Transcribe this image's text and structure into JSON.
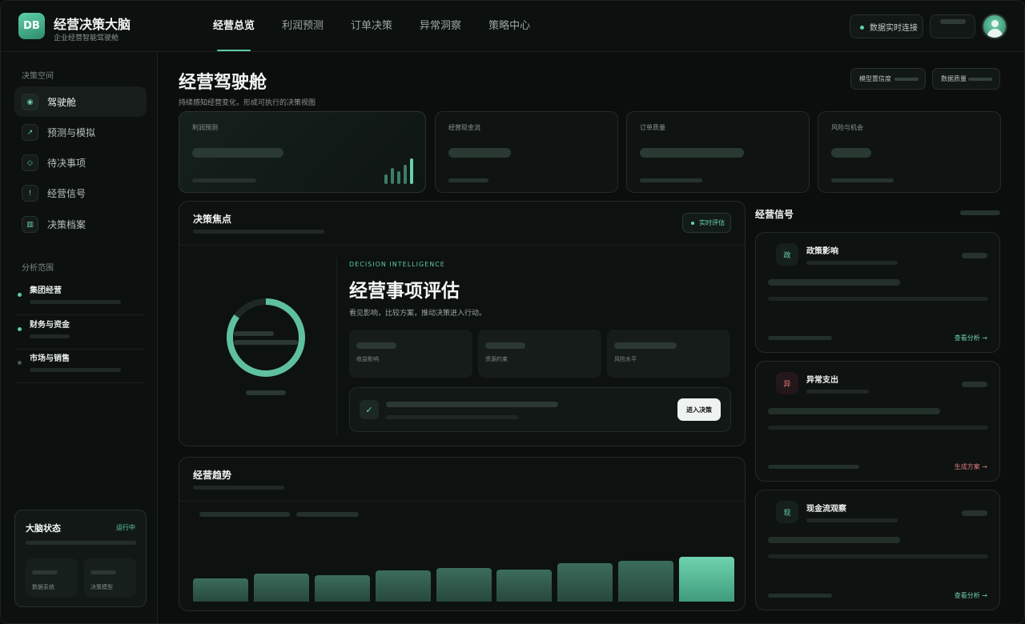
{
  "app": {
    "logo": "DB",
    "title": "经营决策大脑",
    "subtitle": "企业经营智能驾驶舱"
  },
  "nav": {
    "items": [
      "经营总览",
      "利润预测",
      "订单决策",
      "异常洞察",
      "策略中心"
    ],
    "active": "经营总览"
  },
  "topbar": {
    "live_status": "数据实时连接"
  },
  "sidebar": {
    "space_heading": "决策空间",
    "items": [
      {
        "label": "驾驶舱",
        "icon": "target-icon",
        "glyph": "◉"
      },
      {
        "label": "预测与模拟",
        "icon": "trend-arrow-icon",
        "glyph": "↗"
      },
      {
        "label": "待决事项",
        "icon": "diamond-icon",
        "glyph": "◇"
      },
      {
        "label": "经营信号",
        "icon": "alert-icon",
        "glyph": "!"
      },
      {
        "label": "决策档案",
        "icon": "archive-icon",
        "glyph": "▥"
      }
    ],
    "scope_heading": "分析范围",
    "scopes": [
      "集团经营",
      "财务与资金",
      "市场与销售"
    ]
  },
  "brain_status": {
    "title": "大脑状态",
    "status": "运行中",
    "systems": [
      "数据系统",
      "决策模型"
    ]
  },
  "page": {
    "title": "经营驾驶舱",
    "subtitle": "持续感知经营变化，形成可执行的决策视图",
    "chips": [
      "模型置信度",
      "数据质量"
    ]
  },
  "kpis": [
    "利润预测",
    "经营现金流",
    "订单质量",
    "风险与机会"
  ],
  "focus": {
    "title": "决策焦点",
    "badge": "实时评估",
    "eyebrow": "DECISION INTELLIGENCE",
    "headline": "经营事项评估",
    "description": "看见影响，比较方案，推动决策进入行动。",
    "metrics": [
      "收益影响",
      "资源约束",
      "风险水平"
    ],
    "action_button": "进入决策",
    "check_glyph": "✓"
  },
  "trend": {
    "title": "经营趋势"
  },
  "chart_data": {
    "type": "bar",
    "title": "经营趋势",
    "values": [
      29,
      35,
      33,
      39,
      42,
      40,
      48,
      51,
      56
    ],
    "ylim": [
      0,
      84
    ],
    "highlight_last": true
  },
  "signals": {
    "title": "经营信号",
    "cards": [
      {
        "badge": "政",
        "title": "政策影响",
        "link": "查看分析 →",
        "tone": "green"
      },
      {
        "badge": "异",
        "title": "异常支出",
        "link": "生成方案 →",
        "tone": "red"
      },
      {
        "badge": "现",
        "title": "现金流观察",
        "link": "查看分析 →",
        "tone": "green"
      }
    ]
  },
  "colors": {
    "accent": "#5fd0a9",
    "alert": "#e07b80",
    "background": "#0b0e0d"
  }
}
